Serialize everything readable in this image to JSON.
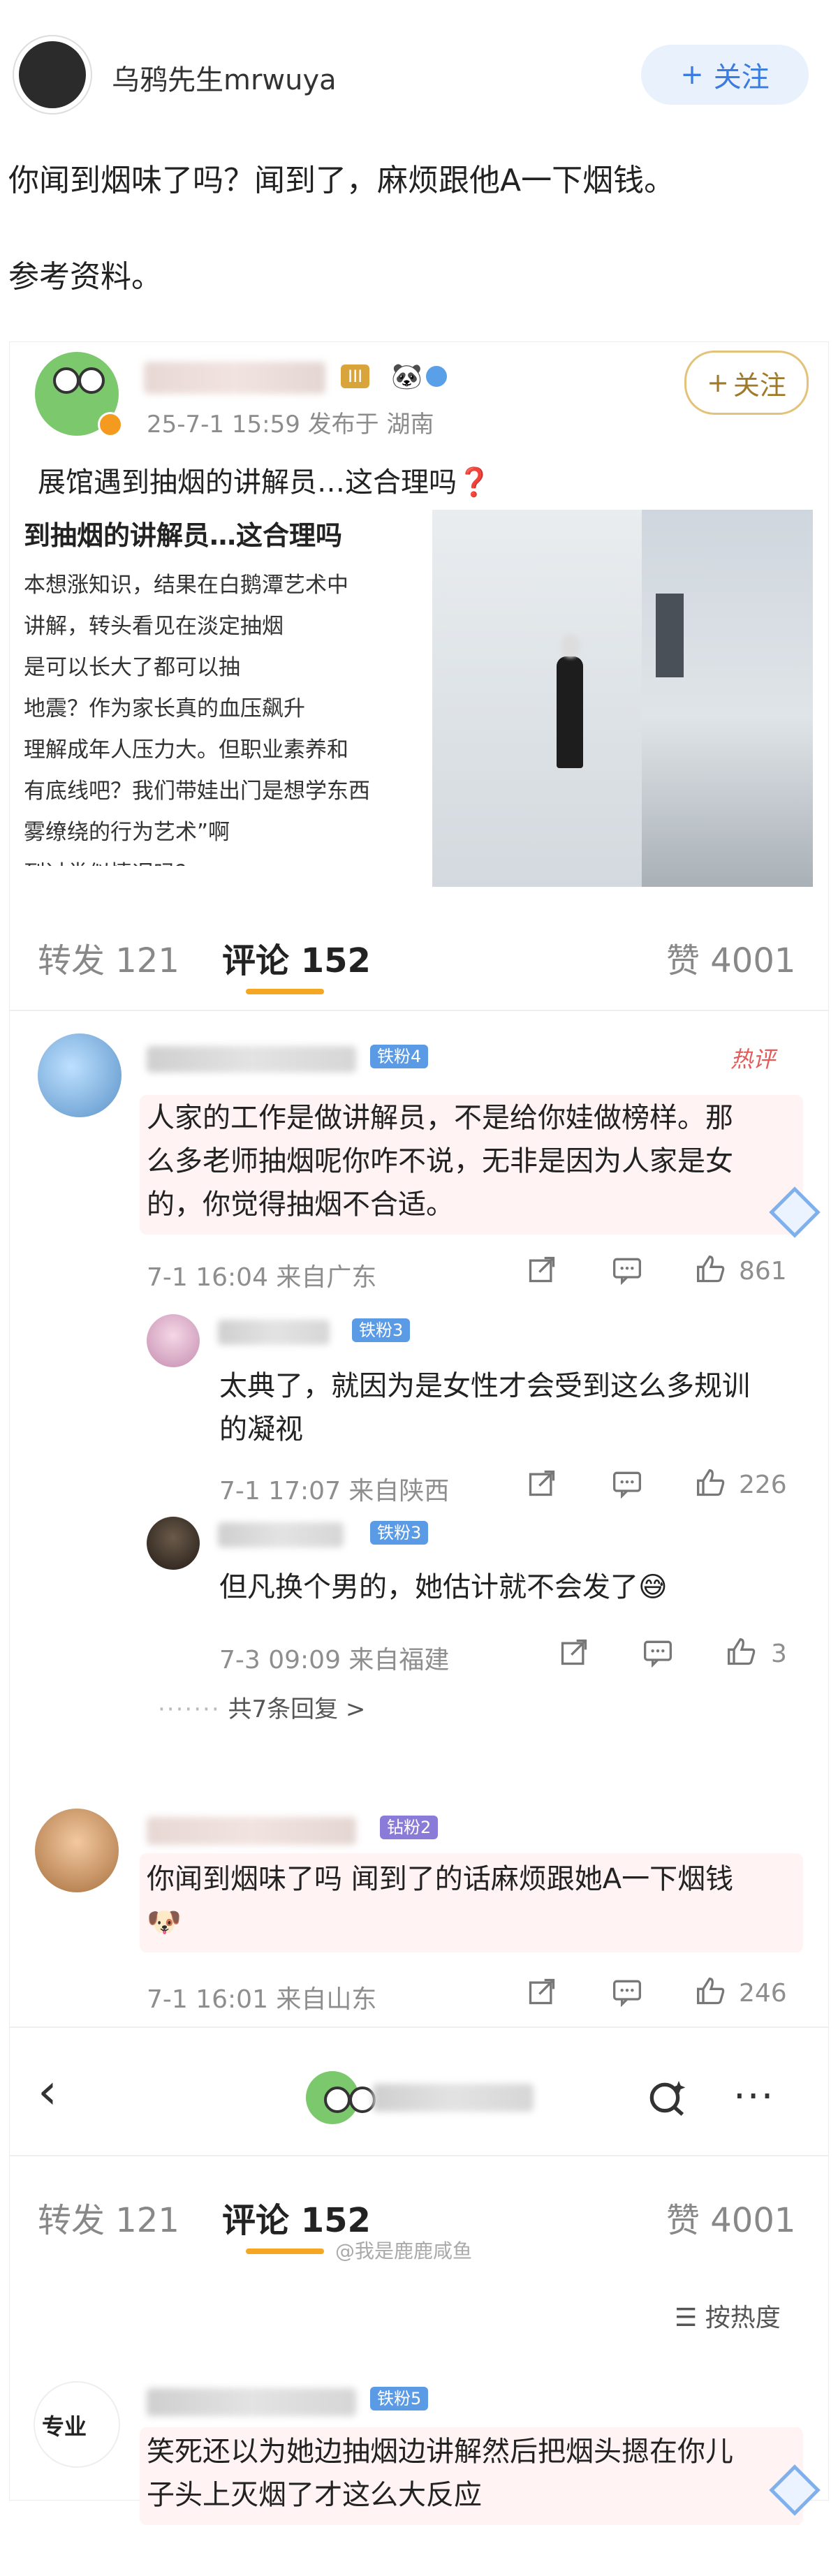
{
  "post": {
    "author": "乌鸦先生mrwuya",
    "follow": "关注",
    "text": "你闻到烟味了吗？闻到了，麻烦跟他A一下烟钱。",
    "text2": "参考资料。"
  },
  "inner_post": {
    "rank": "III",
    "time_location": "25-7-1 15:59  发布于 湖南",
    "follow": "关注",
    "title": "展馆遇到抽烟的讲解员…这合理吗",
    "image_text": {
      "heading": "到抽烟的讲解员…这合理吗",
      "lines": [
        "本想涨知识，结果在白鹅潭艺术中",
        "讲解，转头看见在淡定抽烟",
        "是可以长大了都可以抽",
        "地震？作为家长真的血压飙升",
        "理解成年人压力大。但职业素养和",
        "有底线吧？我们带娃出门是想学东西",
        "雾缭绕的行为艺术”啊",
        "到过类似情况吗？"
      ]
    }
  },
  "tabs_top": {
    "repost": "转发 121",
    "comments": "评论 152",
    "likes": "赞 4001"
  },
  "comments": [
    {
      "rank": "铁粉4",
      "hot": "热评",
      "text_lines": [
        "人家的工作是做讲解员，不是给你娃做榜样。那",
        "么多老师抽烟呢你咋不说，无非是因为人家是女",
        "的，你觉得抽烟不合适。"
      ],
      "meta": "7-1 16:04  来自广东",
      "likes": "861"
    },
    {
      "rank": "铁粉3",
      "text_lines": [
        "太典了，就因为是女性才会受到这么多规训",
        "的凝视"
      ],
      "meta": "7-1 17:07  来自陕西",
      "likes": "226"
    },
    {
      "rank": "铁粉3",
      "text_lines": [
        "但凡换个男的，她估计就不会发了"
      ],
      "meta": "7-3 09:09  来自福建",
      "likes": "3",
      "more": "共7条回复 >"
    },
    {
      "rank": "钻粉2",
      "text_lines": [
        "你闻到烟味了吗 闻到了的话麻烦跟她A一下烟钱"
      ],
      "meta": "7-1 16:01  来自山东",
      "likes": "246"
    }
  ],
  "watermark": "@我是鹿鹿咸鱼",
  "tabs_bottom": {
    "repost": "转发 121",
    "comments": "评论 152",
    "likes": "赞 4001",
    "sort": "按热度"
  },
  "last_comment": {
    "rank": "铁粉5",
    "avatar_label": "专业",
    "text_lines": [
      "笑死还以为她边抽烟边讲解然后把烟头摁在你儿",
      "子头上灭烟了才这么大反应"
    ]
  }
}
